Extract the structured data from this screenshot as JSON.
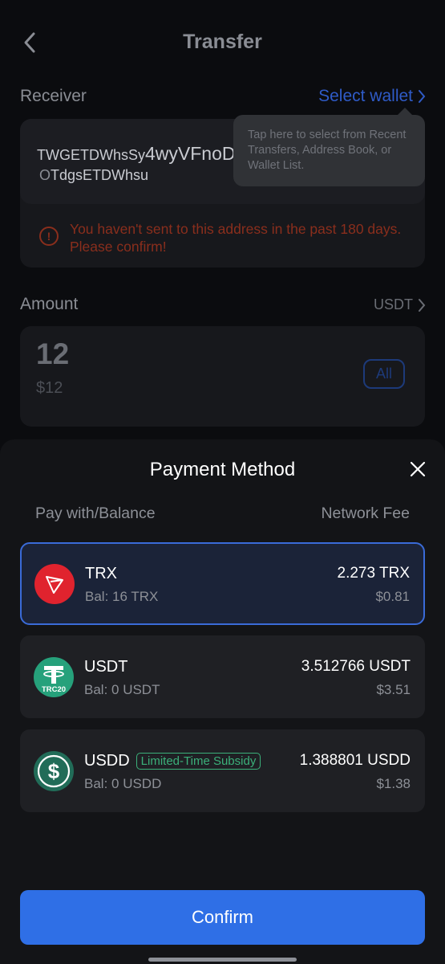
{
  "header": {
    "title": "Transfer"
  },
  "receiver": {
    "label": "Receiver",
    "select_wallet_label": "Select wallet",
    "address_line1_small": "TWGETDWhsSy",
    "address_line1_big": "4wyVFnoD",
    "address_line2": "TdgsETDWhsu",
    "warning": "You haven't sent to this address in the past 180 days. Please confirm!",
    "tooltip": "Tap here to select from Recent Transfers, Address Book, or Wallet List."
  },
  "amount": {
    "label": "Amount",
    "currency": "USDT",
    "value": "12",
    "usd_value": "$12",
    "all_label": "All"
  },
  "payment_sheet": {
    "title": "Payment Method",
    "col_left": "Pay with/Balance",
    "col_right": "Network Fee",
    "options": [
      {
        "name": "TRX",
        "balance": "Bal: 16 TRX",
        "fee_token": "2.273 TRX",
        "fee_usd": "$0.81",
        "icon": "tron-icon",
        "color": "#e0232e",
        "selected": true
      },
      {
        "name": "USDT",
        "balance": "Bal: 0 USDT",
        "fee_token": "3.512766 USDT",
        "fee_usd": "$3.51",
        "icon": "tether-trc20-icon",
        "icon_label": "TRC20",
        "color": "#26a17b",
        "selected": false
      },
      {
        "name": "USDD",
        "badge": "Limited-Time Subsidy",
        "balance": "Bal: 0 USDD",
        "fee_token": "1.388801 USDD",
        "fee_usd": "$1.38",
        "icon": "usdd-icon",
        "color": "#216c58",
        "selected": false
      }
    ],
    "confirm_label": "Confirm"
  }
}
